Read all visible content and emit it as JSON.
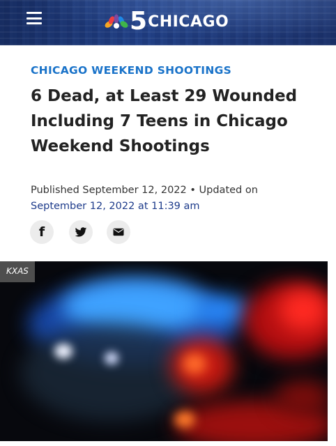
{
  "header": {
    "logo_number": "5",
    "logo_city": "CHICAGO",
    "menu_icon": "hamburger-menu-icon"
  },
  "article": {
    "category": "CHICAGO WEEKEND SHOOTINGS",
    "headline": "6 Dead, at Least 29 Wounded Including 7 Teens in Chicago Weekend Shootings",
    "published_label": "Published",
    "published_date": "September 12, 2022",
    "separator": " • ",
    "updated_label": "Updated on",
    "updated_datetime": "September 12, 2022 at 11:39 am"
  },
  "share": {
    "facebook_glyph": "f",
    "icons": [
      "facebook-icon",
      "twitter-icon",
      "email-icon"
    ]
  },
  "photo": {
    "credit": "KXAS"
  },
  "colors": {
    "category": "#1a73c9",
    "headline": "#222222",
    "meta_link": "#1c3a8a",
    "header_bg": "#1f3a7a"
  }
}
